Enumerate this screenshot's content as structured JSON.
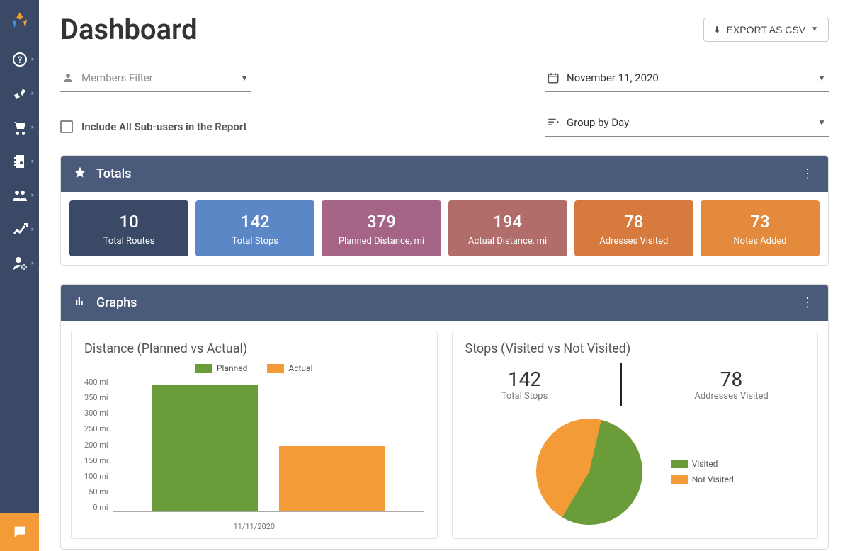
{
  "header": {
    "title": "Dashboard",
    "export_label": "EXPORT AS CSV"
  },
  "filters": {
    "members_placeholder": "Members Filter",
    "include_subusers_label": "Include All Sub-users in the Report",
    "date_value": "November 11, 2020",
    "group_value": "Group by Day"
  },
  "totals_panel": {
    "title": "Totals",
    "cards": [
      {
        "value": "10",
        "label": "Total Routes"
      },
      {
        "value": "142",
        "label": "Total Stops"
      },
      {
        "value": "379",
        "label": "Planned Distance, mi"
      },
      {
        "value": "194",
        "label": "Actual Distance, mi"
      },
      {
        "value": "78",
        "label": "Adresses Visited"
      },
      {
        "value": "73",
        "label": "Notes Added"
      }
    ]
  },
  "graphs_panel": {
    "title": "Graphs",
    "distance_chart_title": "Distance (Planned vs Actual)",
    "stops_chart_title": "Stops (Visited vs Not Visited)",
    "legend_planned": "Planned",
    "legend_actual": "Actual",
    "legend_visited": "Visited",
    "legend_not_visited": "Not Visited",
    "y_ticks": [
      "400 mi",
      "350 mi",
      "300 mi",
      "250 mi",
      "200 mi",
      "150 mi",
      "100 mi",
      "50 mi",
      "0 mi"
    ],
    "x_label": "11/11/2020",
    "stops_total_value": "142",
    "stops_total_label": "Total Stops",
    "stops_visited_value": "78",
    "stops_visited_label": "Addresses Visited"
  },
  "chart_data": [
    {
      "type": "bar",
      "title": "Distance (Planned vs Actual)",
      "categories": [
        "11/11/2020"
      ],
      "series": [
        {
          "name": "Planned",
          "values": [
            379
          ],
          "color": "#6a9c3a"
        },
        {
          "name": "Actual",
          "values": [
            194
          ],
          "color": "#f39c37"
        }
      ],
      "ylabel": "mi",
      "ylim": [
        0,
        400
      ]
    },
    {
      "type": "pie",
      "title": "Stops (Visited vs Not Visited)",
      "series": [
        {
          "name": "Visited",
          "value": 78,
          "color": "#6a9c3a"
        },
        {
          "name": "Not Visited",
          "value": 64,
          "color": "#f39c37"
        }
      ],
      "total": 142
    }
  ],
  "colors": {
    "sidebar": "#3a4a66",
    "panel_header": "#4a5a7a",
    "accent_orange": "#f39c37",
    "chart_green": "#6a9c3a"
  }
}
